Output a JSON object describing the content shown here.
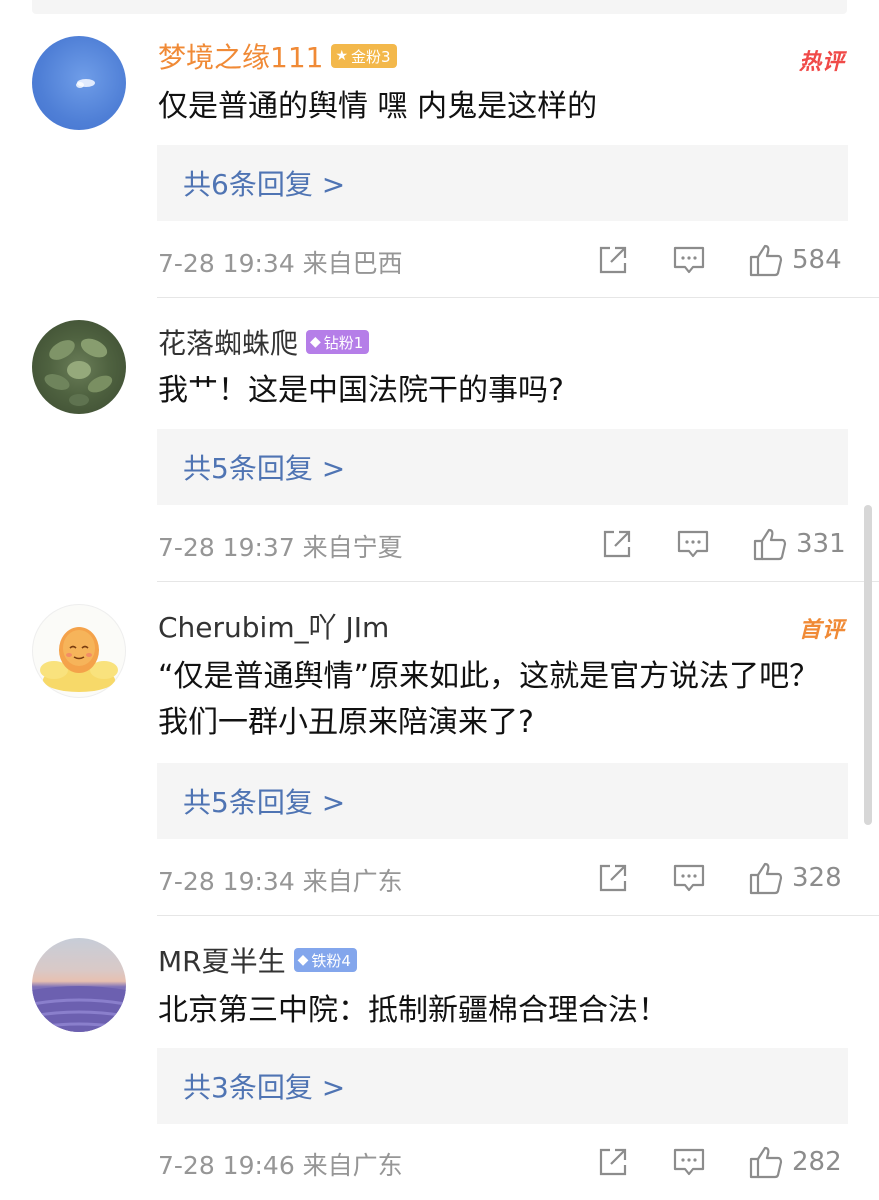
{
  "comments": [
    {
      "username": "梦境之缘111",
      "badge": "金粉3",
      "tag": "热评",
      "text": "仅是普通的舆情 嘿 内鬼是这样的",
      "replies": "共6条回复 >",
      "meta": "7-28 19:34  来自巴西",
      "likes": "584"
    },
    {
      "username": "花落蜘蛛爬",
      "badge": "钻粉1",
      "tag": "",
      "text": "我艹！这是中国法院干的事吗?",
      "replies": "共5条回复 >",
      "meta": "7-28 19:37  来自宁夏",
      "likes": "331"
    },
    {
      "username": "Cherubim_吖 JIm",
      "badge": "",
      "tag": "首评",
      "text": "“仅是普通舆情”原来如此，这就是官方说法了吧？ 我们一群小丑原来陪演来了?",
      "replies": "共5条回复 >",
      "meta": "7-28 19:34  来自广东",
      "likes": "328"
    },
    {
      "username": "MR夏半生",
      "badge": "铁粉4",
      "tag": "",
      "text": "北京第三中院：抵制新疆棉合理合法！",
      "replies": "共3条回复 >",
      "meta": "7-28 19:46  来自广东",
      "likes": "282"
    }
  ],
  "icons": {
    "share": "share-icon",
    "comment": "comment-icon",
    "like": "like-icon"
  },
  "colors": {
    "link": "#4f74b3",
    "hot_red": "#f04a48",
    "hot_orange": "#f08a36",
    "meta_gray": "#969696"
  }
}
